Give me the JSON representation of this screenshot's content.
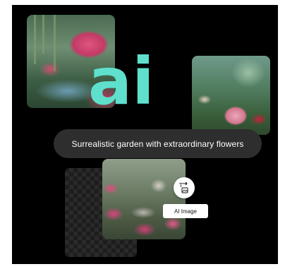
{
  "prompt": {
    "text": "Surrealistic garden with extraordinary flowers"
  },
  "logo": {
    "text": "ai",
    "color": "#5ee0cc"
  },
  "badge": {
    "label": "AI Image"
  },
  "icons": {
    "convert": "text-to-image-icon"
  },
  "colors": {
    "background": "#000000",
    "pill": "#2e2e2e",
    "accent": "#5ee0cc"
  }
}
